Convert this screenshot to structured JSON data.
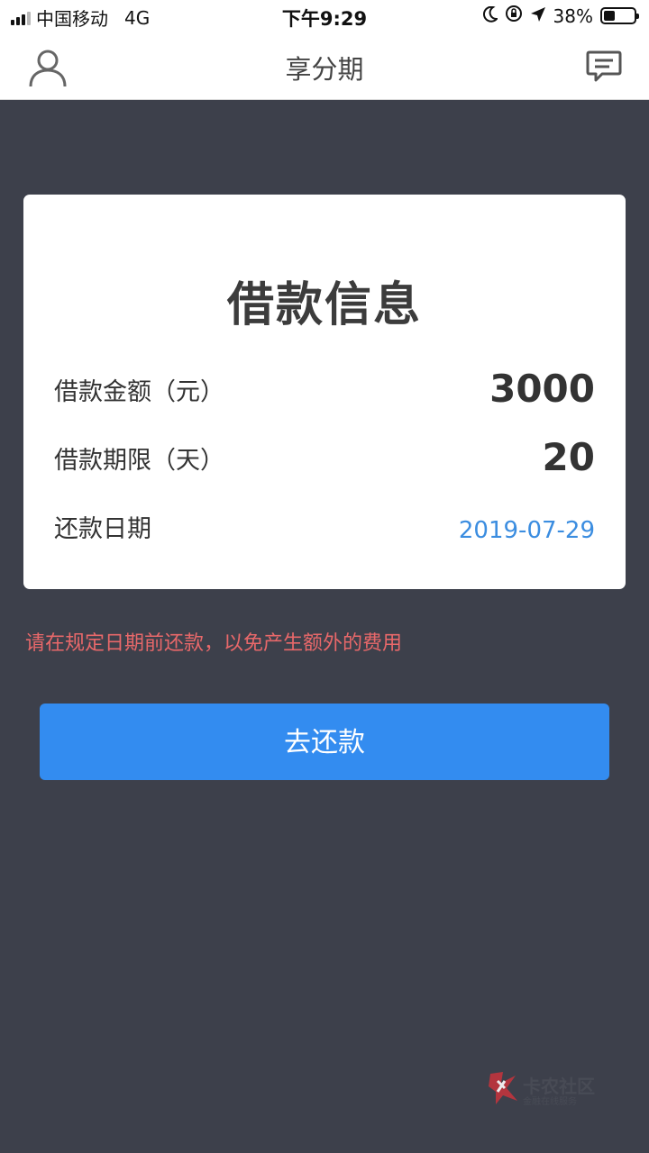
{
  "status_bar": {
    "carrier": "中国移动",
    "network": "4G",
    "time": "下午9:29",
    "battery": "38%",
    "battery_level": 0.38
  },
  "nav": {
    "title": "享分期",
    "left_icon": "user-icon",
    "right_icon": "message-icon"
  },
  "loan_card": {
    "title": "借款信息",
    "rows": [
      {
        "label": "借款金额（元）",
        "value": "3000"
      },
      {
        "label": "借款期限（天）",
        "value": "20"
      },
      {
        "label": "还款日期",
        "value": "2019-07-29"
      }
    ]
  },
  "notice": "请在规定日期前还款，以免产生额外的费用",
  "repay_button": {
    "label": "去还款"
  },
  "watermark": {
    "text": "卡农社区",
    "sub": "金融在线服务"
  },
  "colors": {
    "background": "#3d404b",
    "primary": "#338cf0",
    "notice": "#e8686a",
    "date": "#3b8de0"
  }
}
